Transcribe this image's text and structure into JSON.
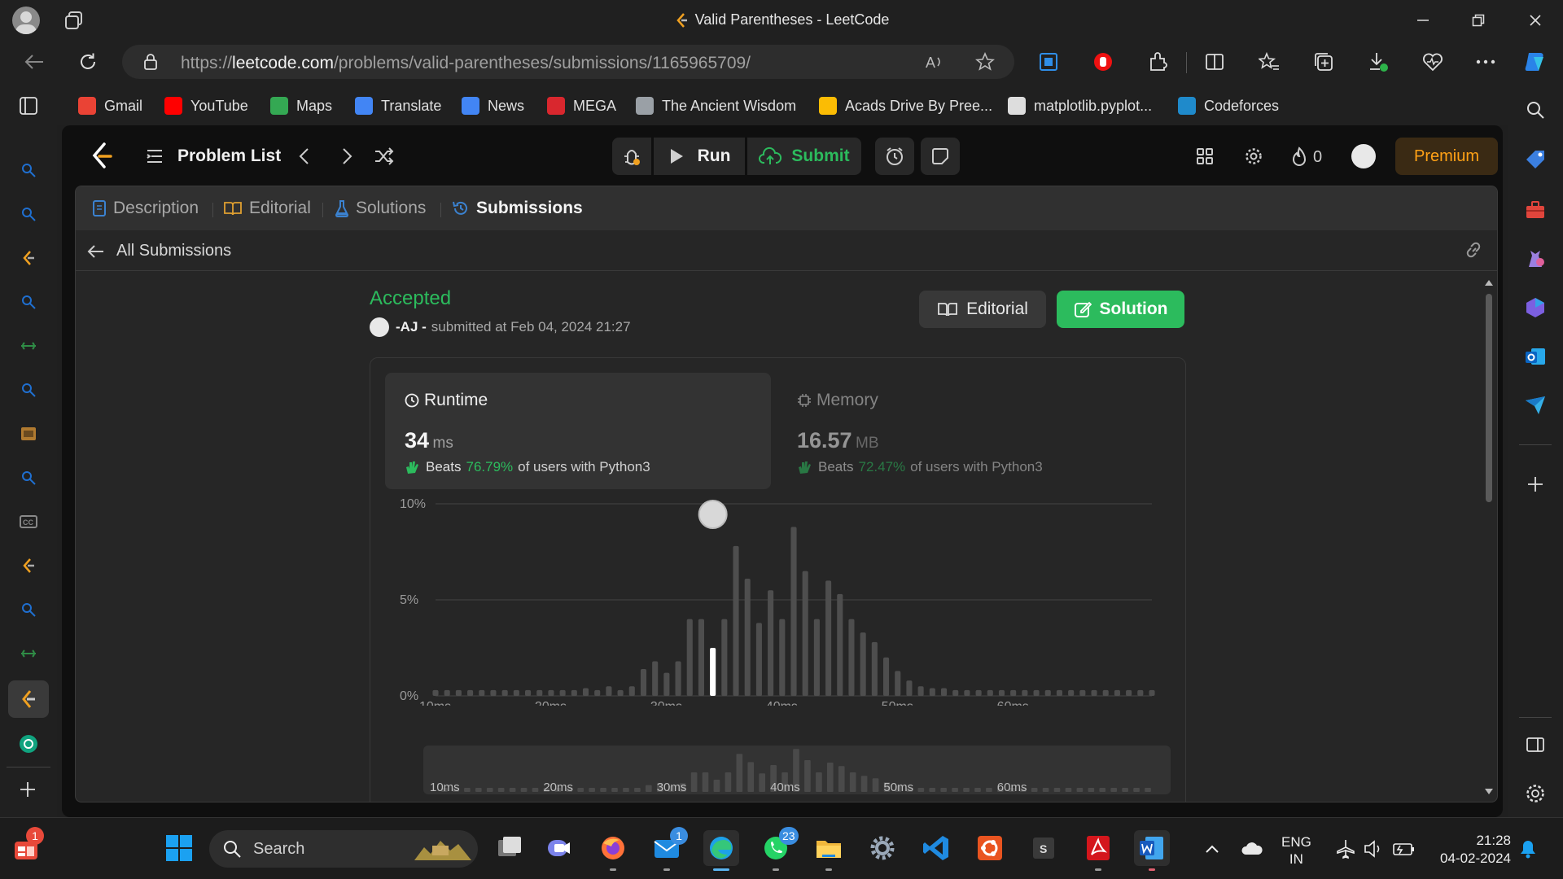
{
  "browser": {
    "tab_title": "Valid Parentheses - LeetCode",
    "url_host": "leetcode.com",
    "url_scheme": "https://",
    "url_path": "/problems/valid-parentheses/submissions/1165965709/",
    "bookmarks": [
      {
        "label": "Gmail",
        "icon": "gmail-icon",
        "color": "#ea4335"
      },
      {
        "label": "YouTube",
        "icon": "youtube-icon",
        "color": "#ff0000"
      },
      {
        "label": "Maps",
        "icon": "maps-icon",
        "color": "#34a853"
      },
      {
        "label": "Translate",
        "icon": "translate-icon",
        "color": "#4285f4"
      },
      {
        "label": "News",
        "icon": "news-icon",
        "color": "#4285f4"
      },
      {
        "label": "MEGA",
        "icon": "mega-icon",
        "color": "#d9272e"
      },
      {
        "label": "The Ancient Wisdom",
        "icon": "bookmark-page-icon",
        "color": "#9aa0a6"
      },
      {
        "label": "Acads Drive By Pree...",
        "icon": "drive-icon",
        "color": "#fbbc04"
      },
      {
        "label": "matplotlib.pyplot...",
        "icon": "matplotlib-icon",
        "color": "#dddddd"
      },
      {
        "label": "Codeforces",
        "icon": "codeforces-icon",
        "color": "#1f8acb"
      }
    ]
  },
  "leetcode": {
    "nav": {
      "problem_list": "Problem List",
      "run": "Run",
      "submit": "Submit",
      "streak": "0",
      "premium": "Premium"
    },
    "tabs": [
      "Description",
      "Editorial",
      "Solutions",
      "Submissions"
    ],
    "back_label": "All Submissions",
    "submission": {
      "status": "Accepted",
      "user": "-AJ -",
      "submitted": "submitted at Feb 04, 2024 21:27",
      "editorial_btn": "Editorial",
      "solution_btn": "Solution"
    },
    "runtime": {
      "title": "Runtime",
      "value": "34",
      "unit": "ms",
      "beats_prefix": "Beats",
      "beats_pct": "76.79%",
      "beats_suffix": "of users with Python3"
    },
    "memory": {
      "title": "Memory",
      "value": "16.57",
      "unit": "MB",
      "beats_prefix": "Beats",
      "beats_pct": "72.47%",
      "beats_suffix": "of users with Python3"
    }
  },
  "chart_data": {
    "type": "bar",
    "title": "",
    "x_unit": "ms",
    "x_ticks": [
      "10ms",
      "20ms",
      "30ms",
      "40ms",
      "50ms",
      "60ms"
    ],
    "y_ticks": [
      "10%",
      "5%",
      "0%"
    ],
    "ylim": [
      0,
      10
    ],
    "highlight_x": 34,
    "x": [
      10,
      11,
      12,
      13,
      14,
      15,
      16,
      17,
      18,
      19,
      20,
      21,
      22,
      23,
      24,
      25,
      26,
      27,
      28,
      29,
      30,
      31,
      32,
      33,
      34,
      35,
      36,
      37,
      38,
      39,
      40,
      41,
      42,
      43,
      44,
      45,
      46,
      47,
      48,
      49,
      50,
      51,
      52,
      53,
      54,
      55,
      56,
      57,
      58,
      59,
      60,
      61,
      62,
      63,
      64,
      65,
      66,
      67,
      68,
      69,
      70,
      71,
      72
    ],
    "values": [
      0.3,
      0.3,
      0.3,
      0.3,
      0.3,
      0.3,
      0.3,
      0.3,
      0.3,
      0.3,
      0.3,
      0.3,
      0.3,
      0.4,
      0.3,
      0.5,
      0.3,
      0.5,
      1.4,
      1.8,
      1.2,
      1.8,
      4.0,
      4.0,
      2.5,
      4.0,
      7.8,
      6.1,
      3.8,
      5.5,
      4.0,
      8.8,
      6.5,
      4.0,
      6.0,
      5.3,
      4.0,
      3.3,
      2.8,
      2.0,
      1.3,
      0.8,
      0.5,
      0.4,
      0.4,
      0.3,
      0.3,
      0.3,
      0.3,
      0.3,
      0.3,
      0.3,
      0.3,
      0.3,
      0.3,
      0.3,
      0.3,
      0.3,
      0.3,
      0.3,
      0.3,
      0.3,
      0.3
    ]
  },
  "taskbar": {
    "search": "Search",
    "lang_top": "ENG",
    "lang_bottom": "IN",
    "time": "21:28",
    "date": "04-02-2024",
    "badge_mail": "1",
    "badge_whatsapp": "23",
    "badge_widget": "1"
  }
}
